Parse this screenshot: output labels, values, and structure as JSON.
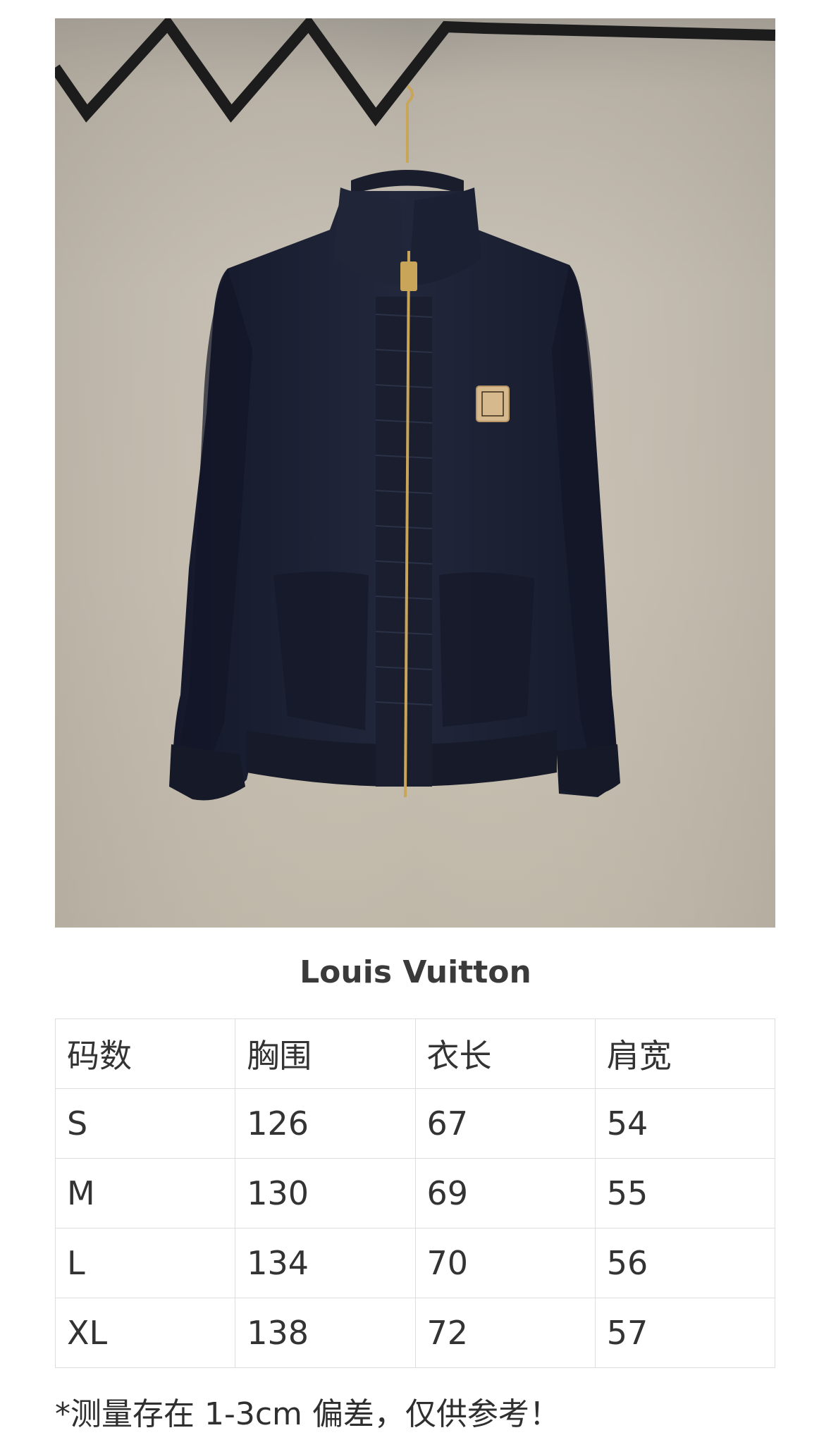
{
  "product_photo": {
    "description_icon": "jacket-photo",
    "colors": {
      "background": "#c5beb1",
      "jacket": "#1d2133",
      "zipper": "#c9a55a",
      "rail": "#1c1c1c"
    }
  },
  "brand": "Louis Vuitton",
  "size_table": {
    "headers": [
      "码数",
      "胸围",
      "衣长",
      "肩宽"
    ],
    "rows": [
      [
        "S",
        "126",
        "67",
        "54"
      ],
      [
        "M",
        "130",
        "69",
        "55"
      ],
      [
        "L",
        "134",
        "70",
        "56"
      ],
      [
        "XL",
        "138",
        "72",
        "57"
      ]
    ]
  },
  "note": "*测量存在 1-3cm 偏差，仅供参考！"
}
